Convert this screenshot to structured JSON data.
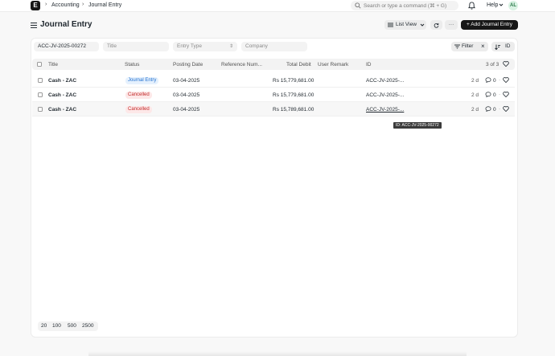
{
  "topbar": {
    "logo_letter": "E",
    "breadcrumbs": [
      "Accounting",
      "Journal Entry"
    ],
    "search_placeholder": "Search or type a command (⌘ + G)",
    "help_label": "Help",
    "avatar_initials": "AL"
  },
  "header": {
    "title": "Journal Entry",
    "list_view_label": "List View",
    "more_label": "···",
    "add_button_label": "+ Add Journal Entry"
  },
  "filters": {
    "name_value": "ACC-JV-2025-00272",
    "title_placeholder": "Title",
    "entry_type_placeholder": "Entry Type",
    "company_placeholder": "Company",
    "filter_label": "Filter",
    "clear_label": "×",
    "sort_label": "ID"
  },
  "table": {
    "columns": [
      "Title",
      "Status",
      "Posting Date",
      "Reference Num...",
      "Total Debit",
      "User Remark",
      "ID"
    ],
    "count_label": "3 of 3",
    "rows": [
      {
        "title": "Cash - ZAC",
        "status": "Journal Entry",
        "status_kind": "info",
        "posting_date": "03-04-2025",
        "total_debit": "Rs 15,779,681.00",
        "id": "ACC-JV-2025-...",
        "age": "2 d",
        "comments": "0"
      },
      {
        "title": "Cash - ZAC",
        "status": "Cancelled",
        "status_kind": "danger",
        "posting_date": "03-04-2025",
        "total_debit": "Rs 15,779,681.00",
        "id": "ACC-JV-2025-...",
        "age": "2 d",
        "comments": "0"
      },
      {
        "title": "Cash - ZAC",
        "status": "Cancelled",
        "status_kind": "danger",
        "posting_date": "03-04-2025",
        "total_debit": "Rs 15,789,681.00",
        "id": "ACC-JV-2025-...",
        "age": "2 d",
        "comments": "0"
      }
    ],
    "tooltip": "ID: ACC-JV-2025-00272"
  },
  "paging": {
    "page_sizes": [
      "20",
      "100",
      "500",
      "2500"
    ]
  },
  "colors": {
    "info_bg": "#e6f1fd",
    "info_fg": "#1f6fd0",
    "danger_bg": "#fde8e8",
    "danger_fg": "#c22b2b",
    "accent": "#171717"
  }
}
